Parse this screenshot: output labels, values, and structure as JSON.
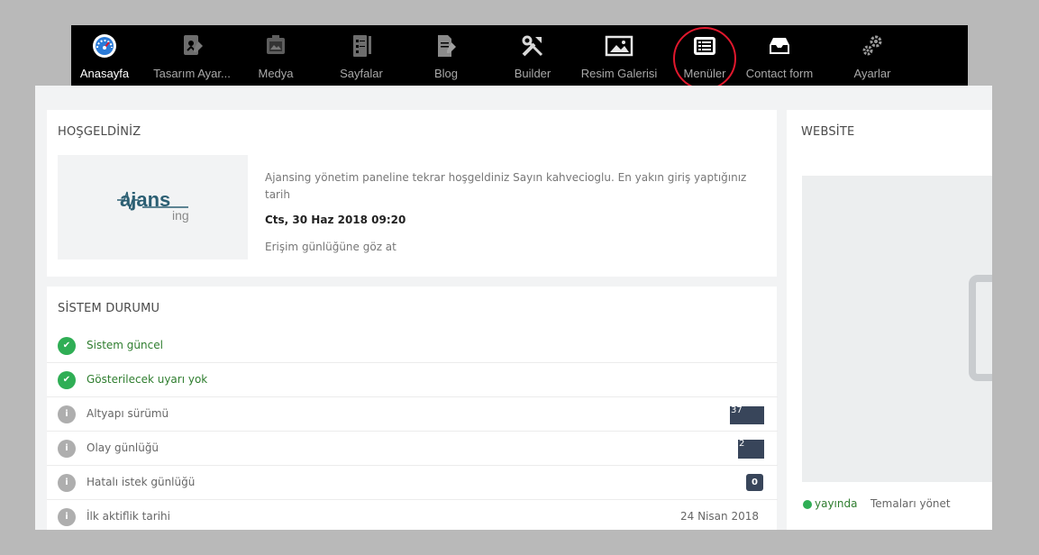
{
  "nav": {
    "home": "Anasayfa",
    "design": "Tasarım Ayar...",
    "media": "Medya",
    "pages": "Sayfalar",
    "blog": "Blog",
    "builder": "Builder",
    "gallery": "Resim Galerisi",
    "menus": "Menüler",
    "contact": "Contact form",
    "settings": "Ayarlar"
  },
  "welcome": {
    "title": "HOŞGELDİNİZ",
    "logo_text": "ajansing",
    "message": "Ajansing yönetim paneline tekrar hoşgeldiniz Sayın kahvecioglu. En yakın giriş yaptığınız tarih",
    "last_login": "Cts, 30 Haz 2018 09:20",
    "access_log_link": "Erişim günlüğüne göz at"
  },
  "system": {
    "title": "SİSTEM DURUMU",
    "rows": [
      {
        "label": "Sistem güncel"
      },
      {
        "label": "Gösterilecek uyarı yok"
      },
      {
        "label": "Altyapı sürümü",
        "value": "37"
      },
      {
        "label": "Olay günlüğü",
        "value": "2"
      },
      {
        "label": "Hatalı istek günlüğü",
        "value": "0"
      },
      {
        "label": "İlk aktiflik tarihi",
        "value": "24 Nisan 2018"
      }
    ]
  },
  "website": {
    "title": "WEBSİTE",
    "status": "yayında",
    "manage_themes": "Temaları yönet"
  },
  "colors": {
    "topbar": "#000000",
    "highlight": "#e0182d",
    "success": "#2fae55",
    "badge_dark": "#38455a"
  }
}
